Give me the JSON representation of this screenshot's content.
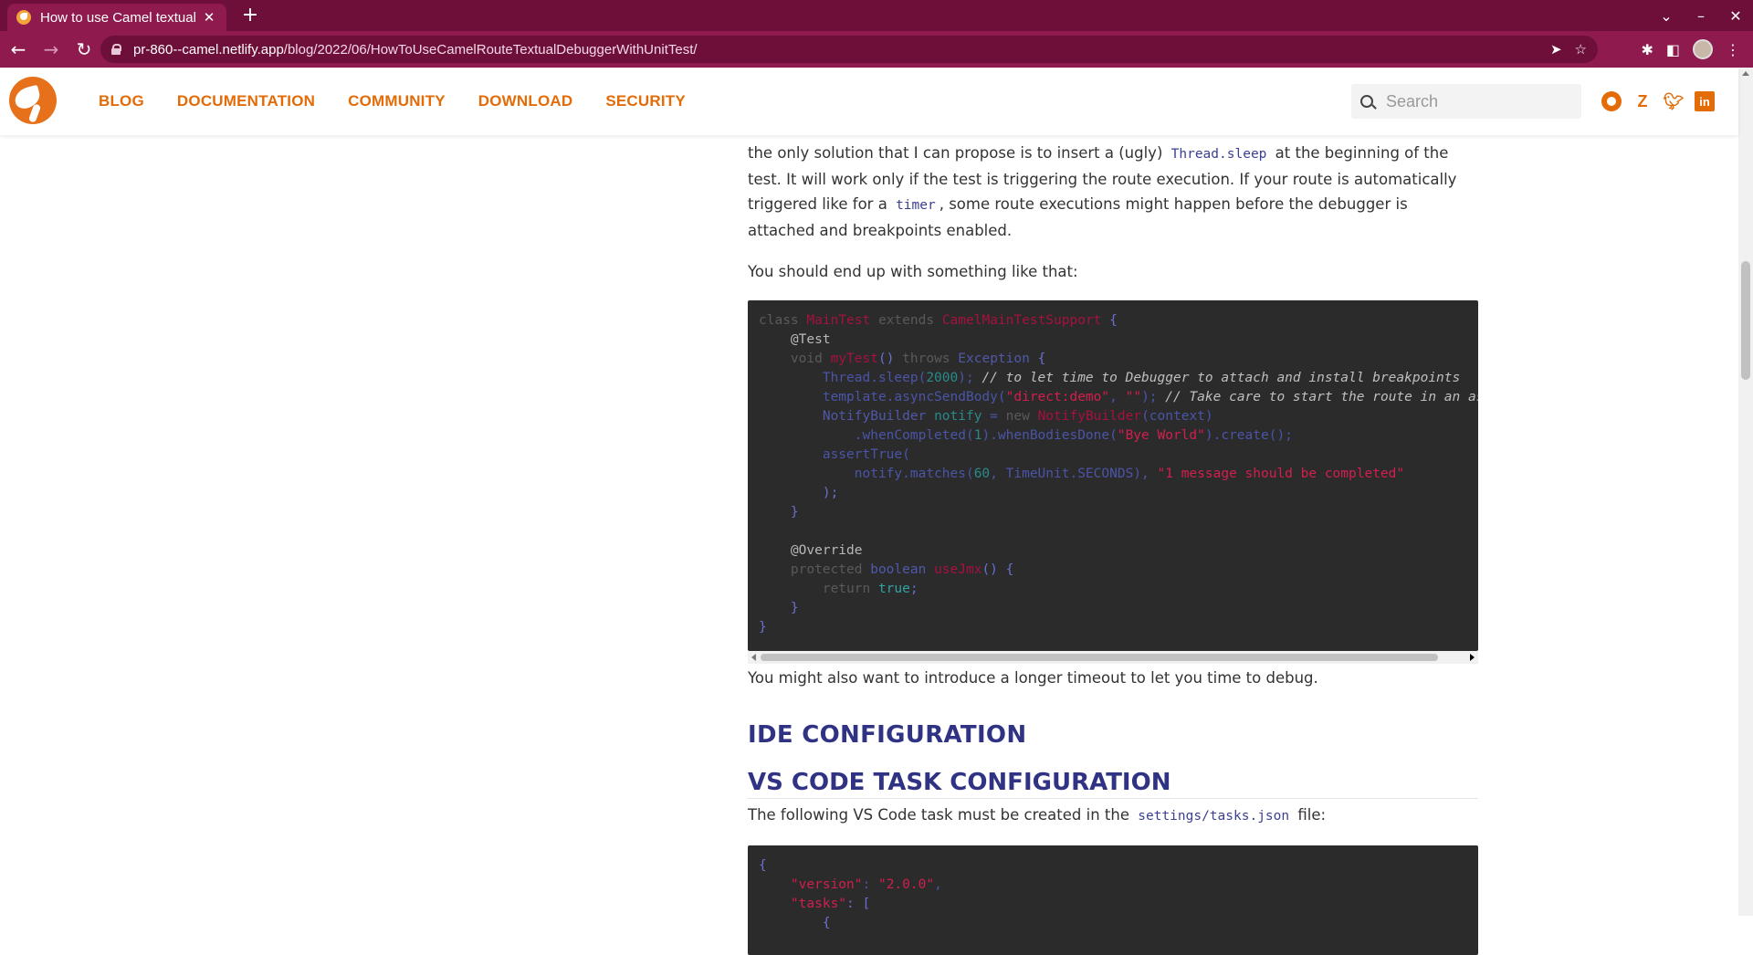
{
  "browser": {
    "tab_title": "How to use Camel textual",
    "tab_close": "✕",
    "new_tab": "+",
    "url_host": "pr-860--camel.netlify.app",
    "url_path": "/blog/2022/06/HowToUseCamelRouteTextualDebuggerWithUnitTest/",
    "window_controls": [
      "⌄",
      "–",
      "✕"
    ]
  },
  "site": {
    "nav": [
      "BLOG",
      "DOCUMENTATION",
      "COMMUNITY",
      "DOWNLOAD",
      "SECURITY"
    ],
    "search_placeholder": "Search",
    "accent_color": "#e36c09",
    "heading_color": "#303284"
  },
  "article": {
    "p1_a": "the only solution that I can propose is to insert a (ugly)",
    "p1_code1": "Thread.sleep",
    "p1_b": "at the beginning of the test. It will work only if the test is triggering the route execution. If your route is automatically triggered like for a",
    "p1_code2": "timer",
    "p1_c": ", some route executions might happen before the debugger is attached and breakpoints enabled.",
    "p2": "You should end up with something like that:",
    "code1": {
      "l1_kw": "class ",
      "l1_cls": "MainTest",
      "l1_ext": " extends ",
      "l1_sup": "CamelMainTestSupport",
      "l1_end": " {",
      "l2": "    @Test",
      "l3_kw": "    void ",
      "l3_met": "myTest",
      "l3_par": "()",
      "l3_thr": " throws ",
      "l3_typ": "Exception",
      "l3_end": " {",
      "l4_met": "        Thread.sleep(",
      "l4_num": "2000",
      "l4_end": ");",
      "l4_cmt": " // to let time to Debugger to attach and install breakpoints",
      "l5_met": "        template.asyncSendBody(",
      "l5_str1": "\"direct:demo\"",
      "l5_sep": ", ",
      "l5_str2": "\"\"",
      "l5_end": ");",
      "l5_cmt": " // Take care to start the route in an asynchronous way",
      "l6_typ": "        NotifyBuilder ",
      "l6_var": "notify",
      "l6_eq": " = ",
      "l6_kw": "new ",
      "l6_cls": "NotifyBuilder",
      "l6_end": "(context)",
      "l7_met": "            .whenCompleted(",
      "l7_num": "1",
      "l7_mid": ").whenBodiesDone(",
      "l7_str": "\"Bye World\"",
      "l7_end": ").create();",
      "l8": "        assertTrue(",
      "l9_met": "            notify.matches(",
      "l9_num": "60",
      "l9_mid": ", TimeUnit.SECONDS), ",
      "l9_str": "\"1 message should be completed\"",
      "l10": "        );",
      "l11": "    }",
      "l12": "",
      "l13": "    @Override",
      "l14_kw": "    protected ",
      "l14_typ": "boolean ",
      "l14_met": "useJmx",
      "l14_end": "() {",
      "l15_kw": "        return ",
      "l15_tru": "true",
      "l15_end": ";",
      "l16": "    }",
      "l17": "}"
    },
    "p3": "You might also want to introduce a longer timeout to let you time to debug.",
    "h_ide": "IDE CONFIGURATION",
    "h_vscode": "VS CODE TASK CONFIGURATION",
    "p4_a": "The following VS Code task must be created in the",
    "p4_code": "settings/tasks.json",
    "p4_b": "file:",
    "code2": {
      "l1": "{",
      "l2_key": "    \"version\"",
      "l2_sep": ": ",
      "l2_val": "\"2.0.0\"",
      "l2_end": ",",
      "l3_key": "    \"tasks\"",
      "l3_end": ": [",
      "l4": "        {"
    }
  }
}
